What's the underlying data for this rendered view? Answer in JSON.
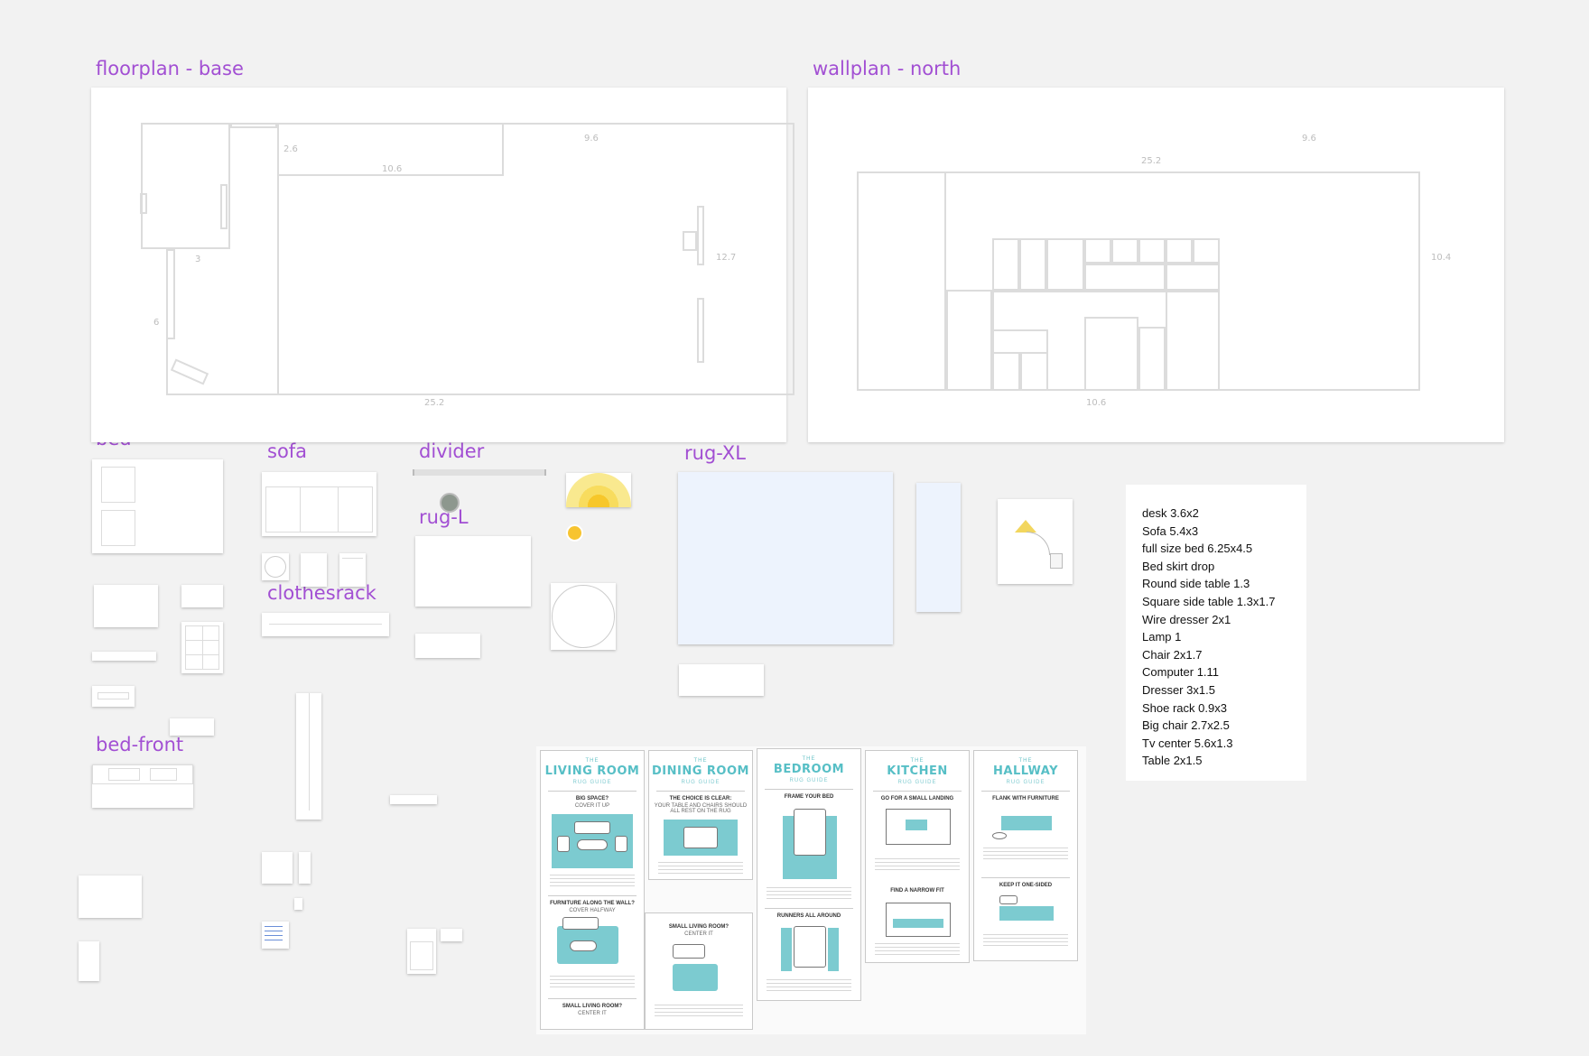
{
  "canvas": {
    "background": "#f2f2f2",
    "label_color": "#a24fd3"
  },
  "frames": {
    "floorplan_base": "floorplan - base",
    "wallplan_north": "wallplan - north",
    "bed": "bed",
    "sofa": "sofa",
    "divider": "divider",
    "rug_l": "rug-L",
    "rug_xl": "rug-XL",
    "clothesrack": "clothesrack",
    "bed_front": "bed-front"
  },
  "floorplan_dims": {
    "d1": "2.6",
    "d2": "10.6",
    "d3": "9.6",
    "d4": "12.7",
    "d5": "3",
    "d6": "6",
    "d7": "25.2"
  },
  "wallplan_dims": {
    "d1": "9.6",
    "d2": "25.2",
    "d3": "10.4",
    "d4": "10.6"
  },
  "notes": [
    "desk 3.6x2",
    "Sofa 5.4x3",
    "full size bed 6.25x4.5",
    "Bed skirt drop",
    "Round side table 1.3",
    "Square side table 1.3x1.7",
    "Wire dresser 2x1",
    "Lamp 1",
    "Chair 2x1.7",
    "Computer 1.11",
    "Dresser 3x1.5",
    "Shoe rack 0.9x3",
    "Big chair 2.7x2.5",
    "Tv center 5.6x1.3",
    "Table 2x1.5"
  ],
  "rug_guides": {
    "the": "THE",
    "subtitle": "RUG GUIDE",
    "living_room": {
      "title": "LIVING ROOM",
      "s1": "BIG SPACE?",
      "s1b": "COVER IT UP",
      "s2": "FURNITURE ALONG THE WALL?",
      "s2b": "COVER HALFWAY",
      "s3": "SMALL LIVING ROOM?",
      "s3b": "CENTER IT"
    },
    "dining_room": {
      "title": "DINING ROOM",
      "s1": "THE CHOICE IS CLEAR:",
      "s1b": "YOUR TABLE AND CHAIRS SHOULD ALL REST ON THE RUG",
      "s2": "SMALL LIVING ROOM?",
      "s2b": "CENTER IT"
    },
    "bedroom": {
      "title": "BEDROOM",
      "s1": "FRAME YOUR BED",
      "s2": "RUNNERS ALL AROUND"
    },
    "kitchen": {
      "title": "KITCHEN",
      "s1": "GO FOR A SMALL LANDING",
      "s2": "FIND A NARROW FIT"
    },
    "hallway": {
      "title": "HALLWAY",
      "s1": "FLANK WITH FURNITURE",
      "s2": "KEEP IT ONE-SIDED"
    },
    "accent": "#57bfc6"
  }
}
